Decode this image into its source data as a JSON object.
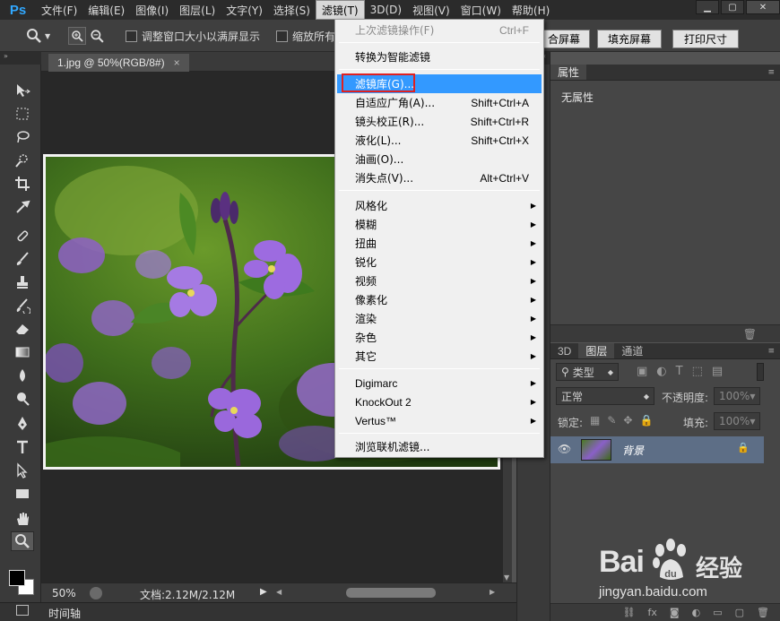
{
  "app": {
    "logo": "Ps"
  },
  "menubar": {
    "items": [
      "文件(F)",
      "编辑(E)",
      "图像(I)",
      "图层(L)",
      "文字(Y)",
      "选择(S)",
      "滤镜(T)",
      "3D(D)",
      "视图(V)",
      "窗口(W)",
      "帮助(H)"
    ],
    "active": "滤镜(T)"
  },
  "options": {
    "resize_windows_label": "调整窗口大小以满屏显示",
    "zoom_all_label": "缩放所有",
    "fit_screen_label": "合屏幕",
    "fill_screen_label": "填充屏幕",
    "print_size_label": "打印尺寸"
  },
  "document": {
    "tab_title": "1.jpg @ 50%(RGB/8#)",
    "zoom": "50%",
    "doc_size": "文档:2.12M/2.12M"
  },
  "timeline": {
    "label": "时间轴"
  },
  "properties_panel": {
    "title": "属性",
    "empty_text": "无属性"
  },
  "layers_panel": {
    "tabs": [
      "3D",
      "图层",
      "通道"
    ],
    "active_tab": "图层",
    "filter_label": "类型",
    "blend_mode": "正常",
    "opacity_label": "不透明度:",
    "opacity_value": "100%",
    "lock_label": "锁定:",
    "fill_label": "填充:",
    "fill_value": "100%",
    "layer_name": "背景"
  },
  "filter_menu": {
    "last_filter": {
      "label": "上次滤镜操作(F)",
      "shortcut": "Ctrl+F"
    },
    "smart_filter": "转换为智能滤镜",
    "group1": [
      {
        "label": "滤镜库(G)...",
        "shortcut": "",
        "highlighted": true
      },
      {
        "label": "自适应广角(A)...",
        "shortcut": "Shift+Ctrl+A"
      },
      {
        "label": "镜头校正(R)...",
        "shortcut": "Shift+Ctrl+R"
      },
      {
        "label": "液化(L)...",
        "shortcut": "Shift+Ctrl+X"
      },
      {
        "label": "油画(O)...",
        "shortcut": ""
      },
      {
        "label": "消失点(V)...",
        "shortcut": "Alt+Ctrl+V"
      }
    ],
    "group2": [
      "风格化",
      "模糊",
      "扭曲",
      "锐化",
      "视频",
      "像素化",
      "渲染",
      "杂色",
      "其它"
    ],
    "group3": [
      "Digimarc",
      "KnockOut 2",
      "Vertus™"
    ],
    "browse": "浏览联机滤镜..."
  },
  "watermark": {
    "brand": "Bai",
    "brand2": "经验",
    "url": "jingyan.baidu.com"
  },
  "colors": {
    "accent": "#3399ff",
    "highlight_border": "#e02020",
    "ps_blue": "#31a8ff",
    "layer_selected": "#5d6e86"
  }
}
